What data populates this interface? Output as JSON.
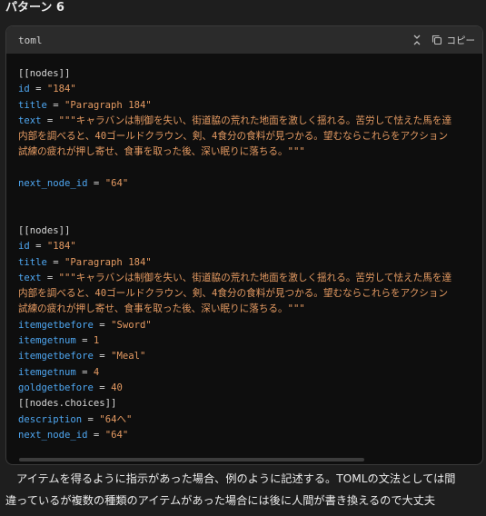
{
  "heading": "パターン 6",
  "code_block": {
    "language": "toml",
    "copy_label": "コピー",
    "blocks": [
      [
        [
          [
            "p",
            "[[nodes]]"
          ]
        ],
        [
          [
            "k",
            "id"
          ],
          [
            "p",
            " = "
          ],
          [
            "s",
            "\"184\""
          ]
        ],
        [
          [
            "k",
            "title"
          ],
          [
            "p",
            " = "
          ],
          [
            "s",
            "\"Paragraph 184\""
          ]
        ],
        [
          [
            "k",
            "text"
          ],
          [
            "p",
            " = "
          ],
          [
            "s",
            "\"\"\"キャラバンは制御を失い、街道脇の荒れた地面を激しく揺れる。苦労して怯えた馬を達"
          ]
        ],
        [
          [
            "s",
            "内部を調べると、40ゴールドクラウン、剣、4食分の食料が見つかる。望むならこれらをアクション"
          ]
        ],
        [
          [
            "s",
            "試練の疲れが押し寄せ、食事を取った後、深い眠りに落ちる。\"\"\""
          ]
        ],
        [
          [
            "p",
            ""
          ]
        ],
        [
          [
            "k",
            "next_node_id"
          ],
          [
            "p",
            " = "
          ],
          [
            "s",
            "\"64\""
          ]
        ],
        [
          [
            "p",
            ""
          ]
        ],
        [
          [
            "p",
            ""
          ]
        ],
        [
          [
            "p",
            "[[nodes]]"
          ]
        ],
        [
          [
            "k",
            "id"
          ],
          [
            "p",
            " = "
          ],
          [
            "s",
            "\"184\""
          ]
        ],
        [
          [
            "k",
            "title"
          ],
          [
            "p",
            " = "
          ],
          [
            "s",
            "\"Paragraph 184\""
          ]
        ],
        [
          [
            "k",
            "text"
          ],
          [
            "p",
            " = "
          ],
          [
            "s",
            "\"\"\"キャラバンは制御を失い、街道脇の荒れた地面を激しく揺れる。苦労して怯えた馬を達"
          ]
        ],
        [
          [
            "s",
            "内部を調べると、40ゴールドクラウン、剣、4食分の食料が見つかる。望むならこれらをアクション"
          ]
        ],
        [
          [
            "s",
            "試練の疲れが押し寄せ、食事を取った後、深い眠りに落ちる。\"\"\""
          ]
        ],
        [
          [
            "k",
            "itemgetbefore"
          ],
          [
            "p",
            " = "
          ],
          [
            "s",
            "\"Sword\""
          ]
        ],
        [
          [
            "k",
            "itemgetnum"
          ],
          [
            "p",
            " = "
          ],
          [
            "n",
            "1"
          ]
        ],
        [
          [
            "k",
            "itemgetbefore"
          ],
          [
            "p",
            " = "
          ],
          [
            "s",
            "\"Meal\""
          ]
        ],
        [
          [
            "k",
            "itemgetnum"
          ],
          [
            "p",
            " = "
          ],
          [
            "n",
            "4"
          ]
        ],
        [
          [
            "k",
            "goldgetbefore"
          ],
          [
            "p",
            " = "
          ],
          [
            "n",
            "40"
          ]
        ],
        [
          [
            "p",
            "[[nodes.choices]]"
          ]
        ],
        [
          [
            "k",
            "description"
          ],
          [
            "p",
            " = "
          ],
          [
            "s",
            "\"64へ\""
          ]
        ],
        [
          [
            "k",
            "next_node_id"
          ],
          [
            "p",
            " = "
          ],
          [
            "s",
            "\"64\""
          ]
        ]
      ]
    ]
  },
  "paragraph": {
    "line1": "アイテムを得るように指示があった場合、例のように記述する。TOMLの文法としては間",
    "line2": "違っているが複数の種類のアイテムがあった場合には後に人間が書き換えるので大丈夫"
  },
  "icons": {
    "collapse": "collapse-icon",
    "copy": "copy-icon"
  }
}
